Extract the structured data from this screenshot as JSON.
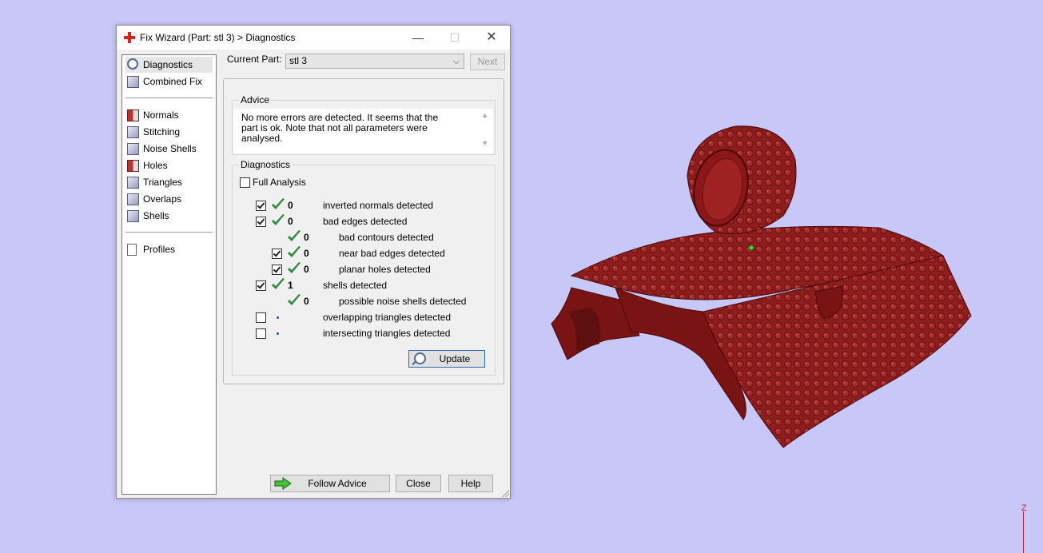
{
  "window": {
    "title": "Fix Wizard (Part: stl 3) > Diagnostics",
    "minimize": "—",
    "maximize": "☐",
    "close": "✕"
  },
  "nav": {
    "items": [
      {
        "label": "Diagnostics",
        "icon": "magnifier-icon"
      },
      {
        "label": "Combined Fix",
        "icon": "cube-icon"
      },
      {
        "label": "Normals",
        "icon": "normals-cube-icon"
      },
      {
        "label": "Stitching",
        "icon": "stitching-cube-icon"
      },
      {
        "label": "Noise Shells",
        "icon": "noise-shells-cube-icon"
      },
      {
        "label": "Holes",
        "icon": "holes-cube-icon"
      },
      {
        "label": "Triangles",
        "icon": "triangles-cube-icon"
      },
      {
        "label": "Overlaps",
        "icon": "overlaps-cube-icon"
      },
      {
        "label": "Shells",
        "icon": "shells-cube-icon"
      },
      {
        "label": "Profiles",
        "icon": "document-icon"
      }
    ]
  },
  "current_part": {
    "label": "Current Part:",
    "value": "stl 3",
    "next_label": "Next"
  },
  "advice": {
    "title": "Advice",
    "text": "No more errors are detected. It seems that the part is ok. Note that not all parameters were analysed."
  },
  "diagnostics": {
    "title": "Diagnostics",
    "full_analysis_label": "Full Analysis",
    "full_analysis_checked": false,
    "rows": [
      {
        "checkbox": true,
        "checked": true,
        "status": "ok",
        "count": "0",
        "label": "inverted normals detected",
        "indent": 0
      },
      {
        "checkbox": true,
        "checked": true,
        "status": "ok",
        "count": "0",
        "label": "bad edges detected",
        "indent": 0
      },
      {
        "checkbox": false,
        "checked": false,
        "status": "ok",
        "count": "0",
        "label": "bad contours detected",
        "indent": 1
      },
      {
        "checkbox": true,
        "checked": true,
        "status": "ok",
        "count": "0",
        "label": "near bad edges detected",
        "indent": 1
      },
      {
        "checkbox": true,
        "checked": true,
        "status": "ok",
        "count": "0",
        "label": "planar holes detected",
        "indent": 1
      },
      {
        "checkbox": true,
        "checked": true,
        "status": "ok",
        "count": "1",
        "label": "shells detected",
        "indent": 0
      },
      {
        "checkbox": false,
        "checked": false,
        "status": "ok",
        "count": "0",
        "label": "possible noise shells detected",
        "indent": 1
      },
      {
        "checkbox": true,
        "checked": false,
        "status": "pending",
        "count": "",
        "label": "overlapping triangles detected",
        "indent": 0
      },
      {
        "checkbox": true,
        "checked": false,
        "status": "pending",
        "count": "",
        "label": "intersecting triangles detected",
        "indent": 0
      }
    ],
    "update_label": "Update"
  },
  "buttons": {
    "follow_advice": "Follow Advice",
    "close": "Close",
    "help": "Help"
  },
  "viewport": {
    "axis_label": "Z"
  },
  "colors": {
    "background": "#c8c8f8",
    "model": "#8b1a1a",
    "check": "#2e8b3a"
  }
}
